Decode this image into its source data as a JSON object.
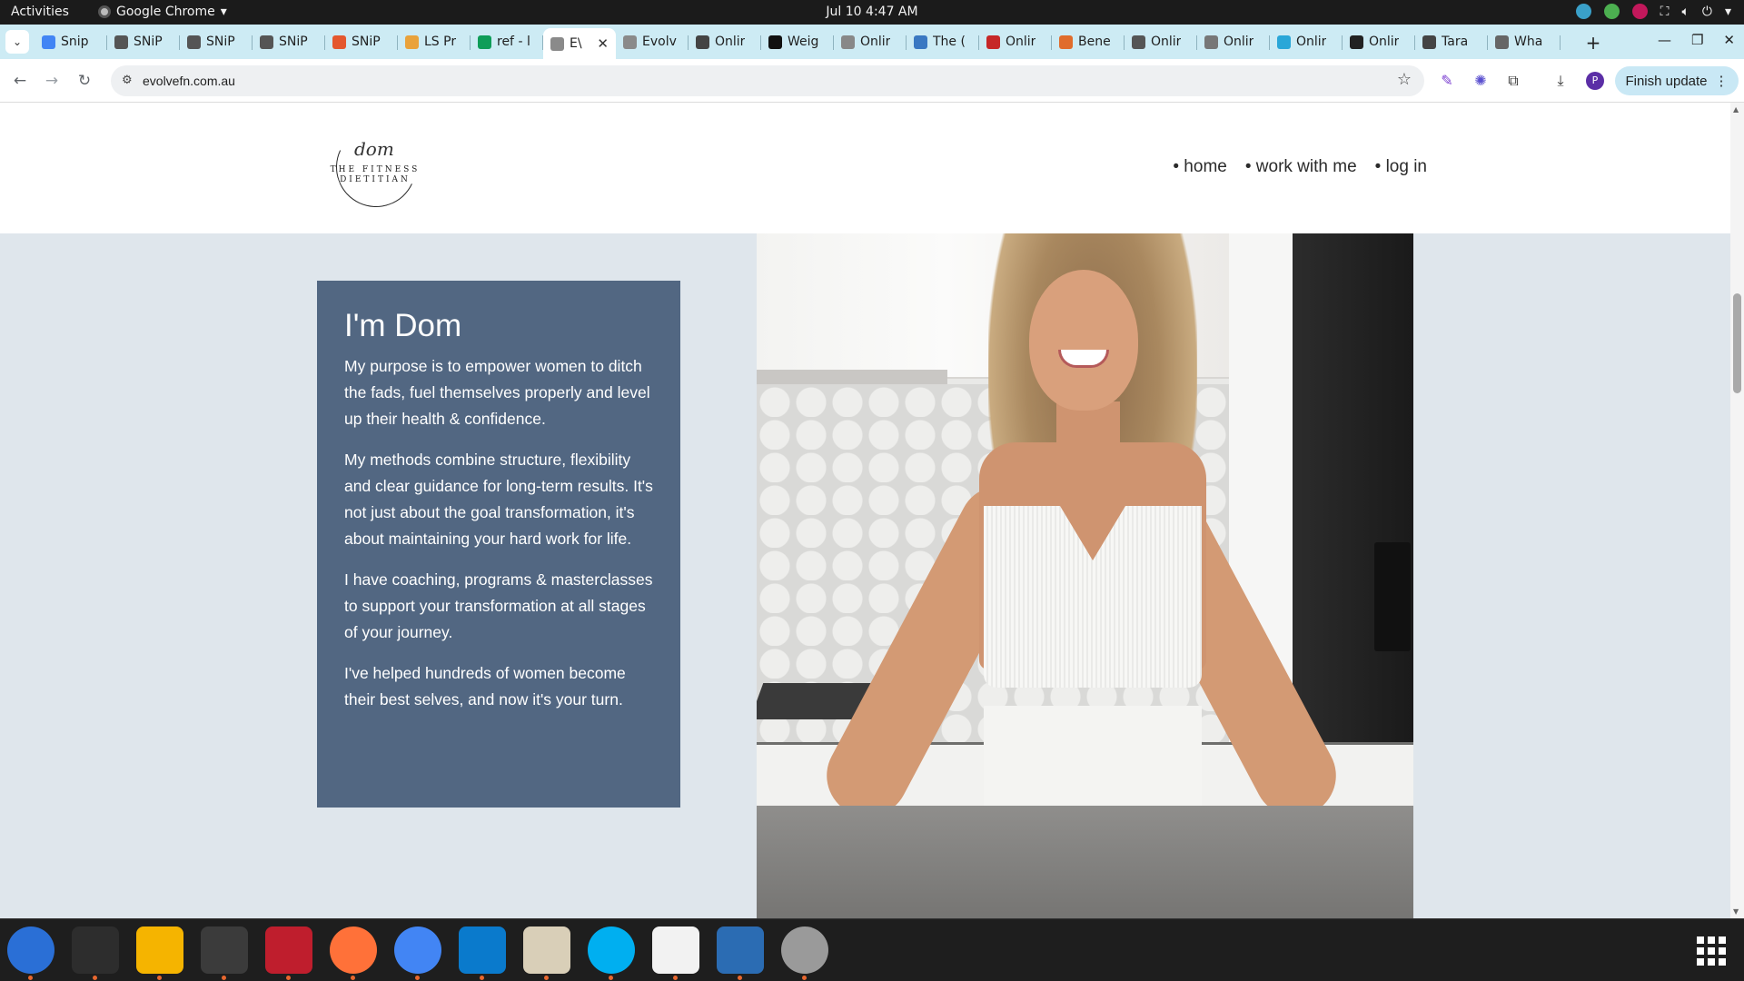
{
  "system_bar": {
    "activities": "Activities",
    "app_name": "Google Chrome",
    "date": "Jul 10",
    "time": "4:47 AM"
  },
  "tabs": [
    {
      "title": "Snip",
      "favicon": "docs-icon",
      "color": "#4285f4"
    },
    {
      "title": "SNiP",
      "favicon": "snip-icon",
      "color": "#555555"
    },
    {
      "title": "SNiP",
      "favicon": "snip-icon",
      "color": "#555555"
    },
    {
      "title": "SNiP",
      "favicon": "snip-icon",
      "color": "#555555"
    },
    {
      "title": "SNiP",
      "favicon": "snip-icon",
      "color": "#e4572e"
    },
    {
      "title": "LS Pr",
      "favicon": "ls-icon",
      "color": "#e9a23b"
    },
    {
      "title": "ref - l",
      "favicon": "sheets-icon",
      "color": "#0f9d58"
    },
    {
      "title": "E\\",
      "favicon": "evolve-icon",
      "color": "#8a8a8a",
      "active": true
    },
    {
      "title": "Evolv",
      "favicon": "evolve-icon",
      "color": "#8a8a8a"
    },
    {
      "title": "Onlir",
      "favicon": "globe-icon",
      "color": "#444444"
    },
    {
      "title": "Weig",
      "favicon": "u-icon",
      "color": "#111111"
    },
    {
      "title": "Onlir",
      "favicon": "page-icon",
      "color": "#888888"
    },
    {
      "title": "The (",
      "favicon": "pattern-icon",
      "color": "#3a78c2"
    },
    {
      "title": "Onlir",
      "favicon": "red-icon",
      "color": "#c62828"
    },
    {
      "title": "Bene",
      "favicon": "code-icon",
      "color": "#e06c2c"
    },
    {
      "title": "Onlir",
      "favicon": "run-icon",
      "color": "#555555"
    },
    {
      "title": "Onlir",
      "favicon": "cat-icon",
      "color": "#777777"
    },
    {
      "title": "Onlir",
      "favicon": "blue-circle-icon",
      "color": "#2aa7d8"
    },
    {
      "title": "Onlir",
      "favicon": "dark-circle-icon",
      "color": "#222222"
    },
    {
      "title": "Tara",
      "favicon": "globe-icon",
      "color": "#444444"
    },
    {
      "title": "Wha",
      "favicon": "page-icon",
      "color": "#666666"
    }
  ],
  "toolbar": {
    "url": "evolvefn.com.au",
    "avatar_letter": "P",
    "finish_update": "Finish update"
  },
  "site": {
    "logo": {
      "script": "dom",
      "line1": "THE FITNESS",
      "line2": "DIETITIAN"
    },
    "nav": [
      "• home",
      "• work with me",
      "• log in"
    ],
    "about": {
      "heading": "I'm Dom",
      "paragraphs": [
        "My purpose is to empower women to ditch the fads, fuel themselves properly and level up their health & confidence.",
        "My methods combine structure, flexibility and clear guidance for long-term results. It's not just about the goal transformation, it's about maintaining your hard work for life.",
        "I have coaching, programs & masterclasses to support your transformation at all stages of your journey.",
        "I've helped hundreds of women become their best selves, and now it's your turn."
      ],
      "card_color": "#526782"
    }
  },
  "dock": [
    {
      "name": "thunderbird-icon",
      "color": "#2a6fd6"
    },
    {
      "name": "terminal-icon",
      "color": "#2d2d2d"
    },
    {
      "name": "calculator-icon",
      "color": "#f5b400"
    },
    {
      "name": "system-monitor-icon",
      "color": "#3b3b3b"
    },
    {
      "name": "filezilla-icon",
      "color": "#bf1e2d"
    },
    {
      "name": "firefox-icon",
      "color": "#ff7139"
    },
    {
      "name": "chrome-icon",
      "color": "#4285f4"
    },
    {
      "name": "vscode-icon",
      "color": "#0a7acc"
    },
    {
      "name": "files-icon",
      "color": "#d9cfb8"
    },
    {
      "name": "skype-icon",
      "color": "#00aff0"
    },
    {
      "name": "text-editor-icon",
      "color": "#f2f2f2"
    },
    {
      "name": "writer-icon",
      "color": "#2b6cb3"
    },
    {
      "name": "disk-icon",
      "color": "#9a9a9a"
    }
  ]
}
